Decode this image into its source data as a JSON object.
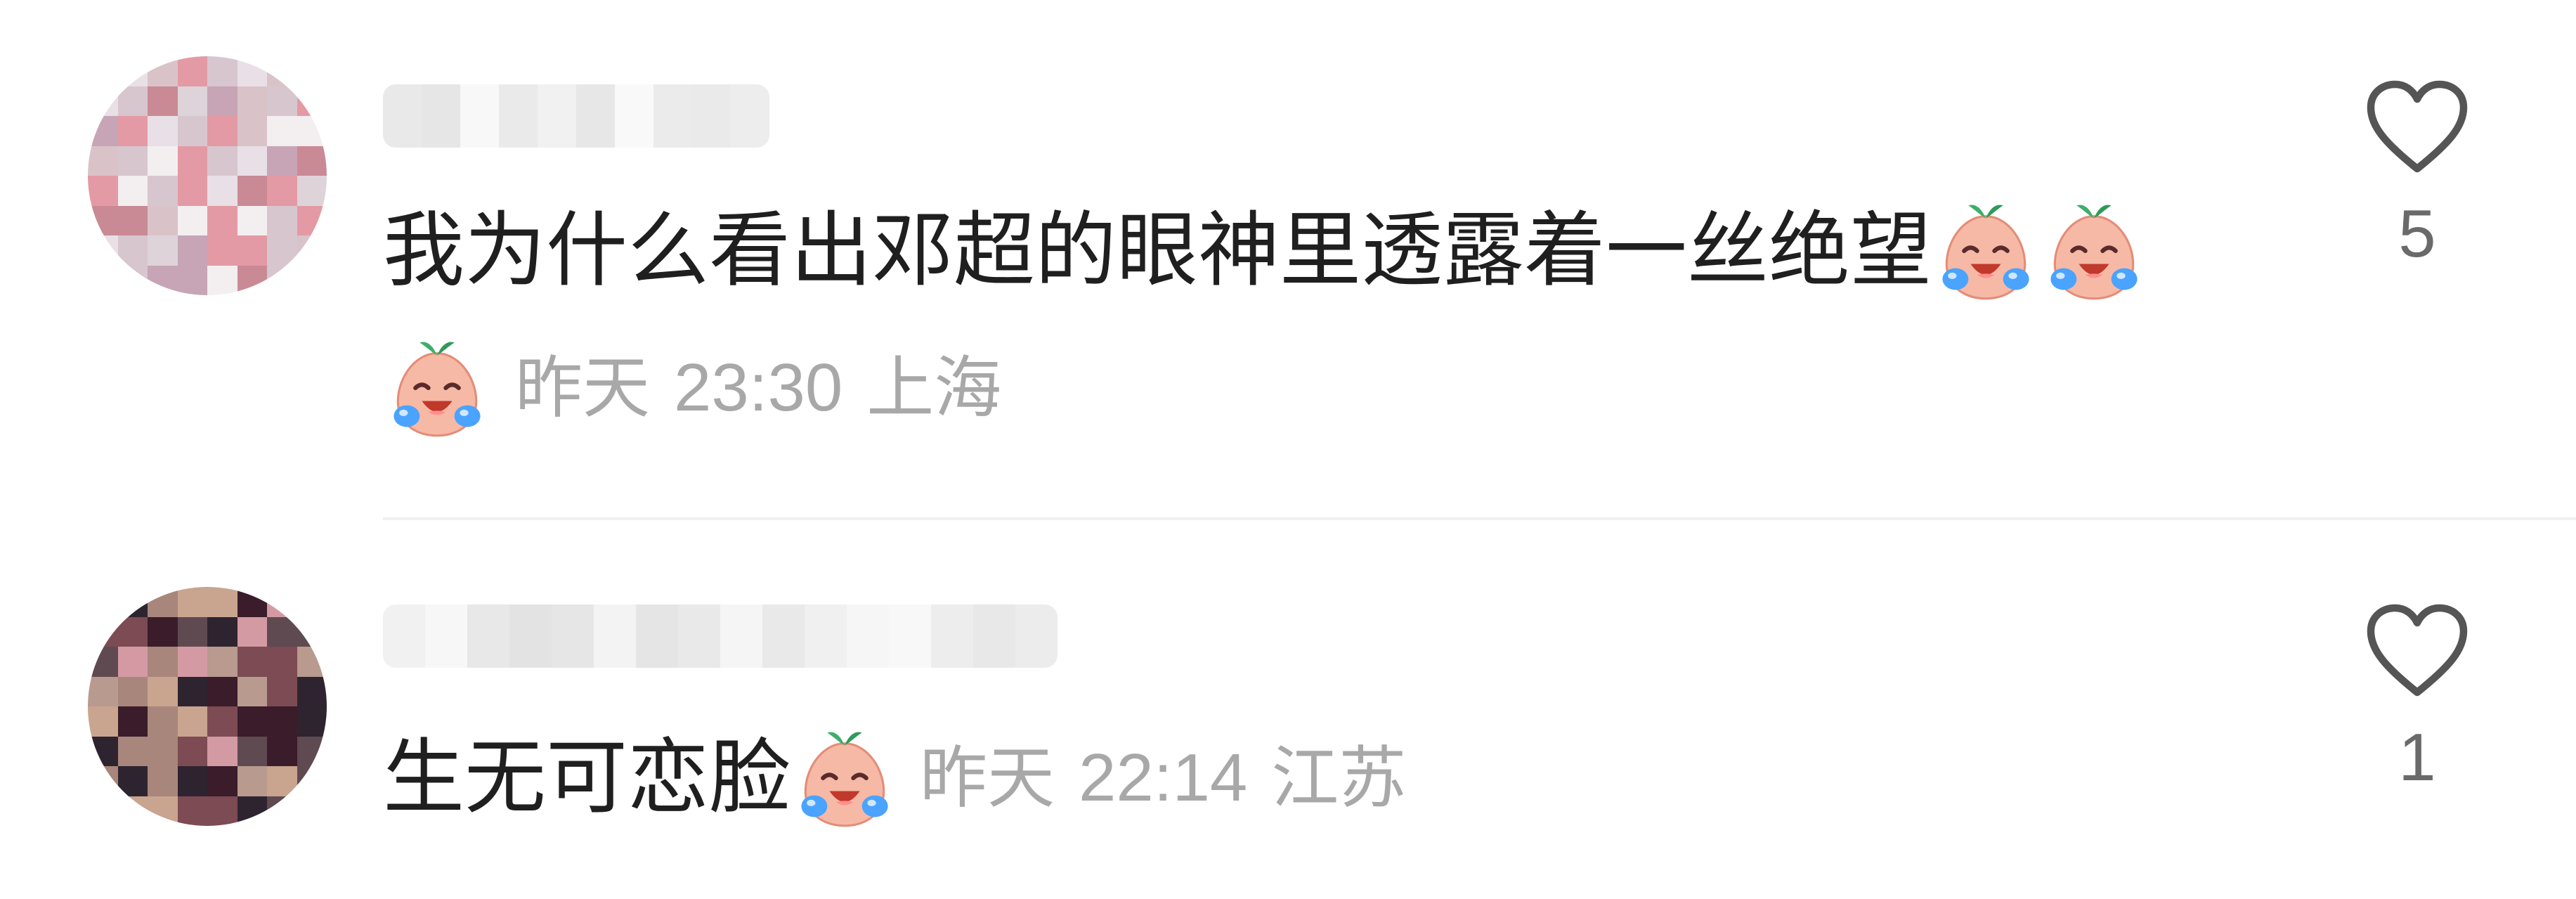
{
  "comments": [
    {
      "text": "我为什么看出邓超的眼神里透露着一丝绝望",
      "date": "昨天",
      "time": "23:30",
      "location": "上海",
      "likes": "5",
      "emoji": "laugh-cry-face-emoji",
      "avatar_colors": [
        "#d9c3c8",
        "#e39aa5",
        "#c98a96",
        "#d8c6cf",
        "#e9dfe6",
        "#c7a4b6",
        "#ddd3d8",
        "#f3eef0"
      ]
    },
    {
      "text": "生无可恋脸",
      "date": "昨天",
      "time": "22:14",
      "location": "江苏",
      "likes": "1",
      "emoji": "laugh-cry-face-emoji",
      "avatar_colors": [
        "#b89a8f",
        "#7c4b53",
        "#3a1c2a",
        "#d49aa3",
        "#2e2430",
        "#a8867b",
        "#c9a48f",
        "#5f4a52"
      ]
    }
  ],
  "colors": {
    "text": "#1f1f1f",
    "meta": "#a8a8a8",
    "like_count": "#6a6a6a",
    "heart_stroke": "#555555",
    "divider": "#f0f0f0"
  }
}
